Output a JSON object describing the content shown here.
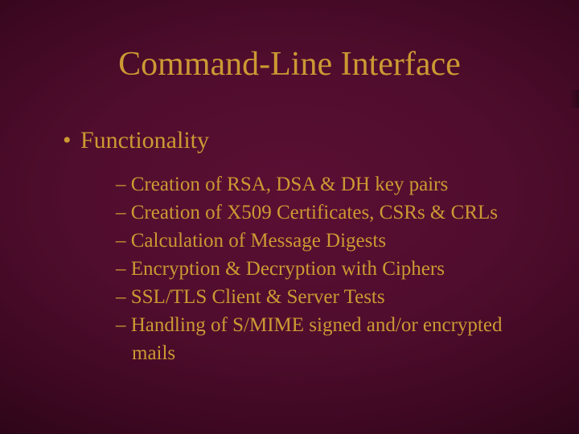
{
  "title": "Command-Line Interface",
  "bullet": {
    "dot": "•",
    "label": "Functionality"
  },
  "dash": "–",
  "subitems": [
    "Creation of RSA, DSA & DH key pairs",
    "Creation of X509 Certificates, CSRs & CRLs",
    "Calculation of Message Digests",
    "Encryption & Decryption with Ciphers",
    "SSL/TLS Client & Server Tests",
    "Handling of S/MIME signed and/or encrypted mails"
  ]
}
